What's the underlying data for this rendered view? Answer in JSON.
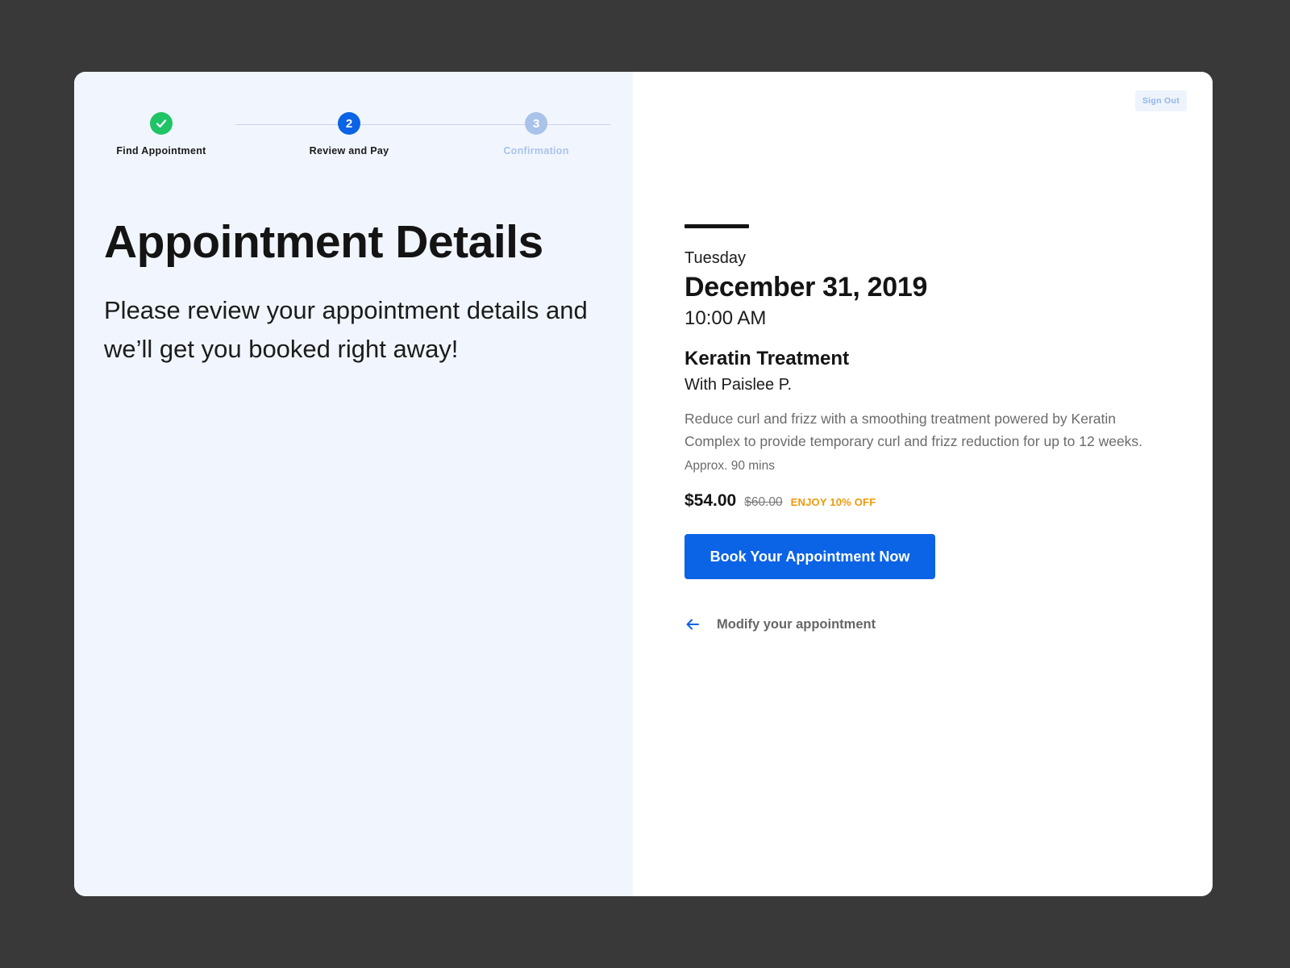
{
  "stepper": {
    "steps": [
      {
        "label": "Find Appointment",
        "status": "done",
        "marker": "✓"
      },
      {
        "label": "Review and Pay",
        "status": "active",
        "marker": "2"
      },
      {
        "label": "Confirmation",
        "status": "pending",
        "marker": "3"
      }
    ]
  },
  "left": {
    "title": "Appointment Details",
    "intro": "Please review your appointment details and we’ll get you booked right away!"
  },
  "header": {
    "sign_out_label": "Sign Out"
  },
  "appointment": {
    "day": "Tuesday",
    "date": "December 31, 2019",
    "time": "10:00 AM",
    "service": "Keratin Treatment",
    "stylist": "With Paislee P.",
    "description": "Reduce curl and frizz with a smoothing treatment powered by Keratin Complex to provide temporary curl and frizz reduction for up to 12 weeks.",
    "duration": "Approx. 90 mins",
    "price": "$54.00",
    "original_price": "$60.00",
    "discount_label": "ENJOY 10% OFF"
  },
  "actions": {
    "book_label": "Book Your Appointment Now",
    "modify_label": "Modify your appointment"
  },
  "colors": {
    "accent": "#0b63e6",
    "success": "#1fc466",
    "pending": "#a9c3ea",
    "discount": "#f0980c"
  },
  "icons": {
    "done_step": "check-icon",
    "modify": "arrow-left-icon"
  }
}
